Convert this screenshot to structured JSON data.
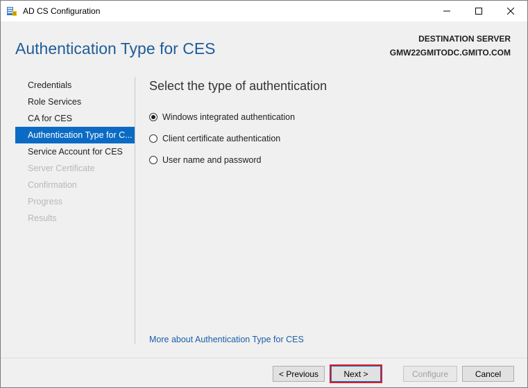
{
  "window": {
    "title": "AD CS Configuration",
    "icon": "server-role-icon"
  },
  "header": {
    "page_title": "Authentication Type for CES",
    "destination_label": "DESTINATION SERVER",
    "destination_server": "GMW22GMITODC.GMITO.COM"
  },
  "nav": {
    "items": [
      {
        "label": "Credentials",
        "state": "normal"
      },
      {
        "label": "Role Services",
        "state": "normal"
      },
      {
        "label": "CA for CES",
        "state": "normal"
      },
      {
        "label": "Authentication Type for C...",
        "state": "selected"
      },
      {
        "label": "Service Account for CES",
        "state": "normal"
      },
      {
        "label": "Server Certificate",
        "state": "disabled"
      },
      {
        "label": "Confirmation",
        "state": "disabled"
      },
      {
        "label": "Progress",
        "state": "disabled"
      },
      {
        "label": "Results",
        "state": "disabled"
      }
    ]
  },
  "content": {
    "heading": "Select the type of authentication",
    "options": [
      {
        "label": "Windows integrated authentication",
        "checked": true
      },
      {
        "label": "Client certificate authentication",
        "checked": false
      },
      {
        "label": "User name and password",
        "checked": false
      }
    ],
    "more_link": "More about Authentication Type for CES"
  },
  "footer": {
    "previous_label": "< Previous",
    "next_label": "Next >",
    "configure_label": "Configure",
    "cancel_label": "Cancel"
  },
  "colors": {
    "accent": "#0b6bc4",
    "title_blue": "#1f5c99",
    "highlight_red": "#e5171f"
  }
}
